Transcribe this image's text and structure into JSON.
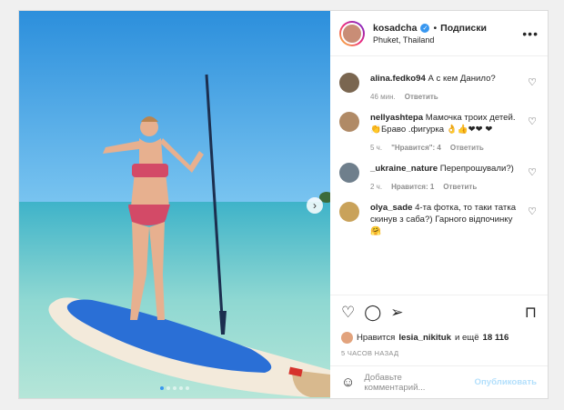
{
  "post": {
    "username": "kosadcha",
    "bullet": "•",
    "follow_label": "Подписки",
    "location": "Phuket, Thailand",
    "more_icon": "more-horizontal-icon"
  },
  "comments": [
    {
      "user": "alina.fedko94",
      "text": "А с кем Данило?",
      "time": "46 мин.",
      "likes": "",
      "reply": "Ответить",
      "avatar_color": "#7a6650"
    },
    {
      "user": "nellyashtepa",
      "text": "Мамочка троих детей.👏Браво .фигурка 👌👍❤❤ ❤",
      "time": "5 ч.",
      "likes": "\"Нравится\": 4",
      "reply": "Ответить",
      "avatar_color": "#b08a66"
    },
    {
      "user": "_ukraine_nature",
      "text": "Перепрошували?)",
      "time": "2 ч.",
      "likes": "Нравится: 1",
      "reply": "Ответить",
      "avatar_color": "#6f7f8c"
    },
    {
      "user": "olya_sade",
      "text": "4-та фотка, то таки татка скинув з саба?) Гарного відпочинку 🤗",
      "time": "",
      "likes": "",
      "reply": "",
      "avatar_color": "#c9a25a"
    }
  ],
  "likes": {
    "prefix": "Нравится",
    "user": "lesia_nikituk",
    "middle": "и ещё",
    "count": "18 116"
  },
  "time_ago": "5 ЧАСОВ НАЗАД",
  "add_comment": {
    "placeholder": "Добавьте комментарий...",
    "publish": "Опубликовать"
  },
  "carousel": {
    "slides": 5,
    "active": 1
  }
}
